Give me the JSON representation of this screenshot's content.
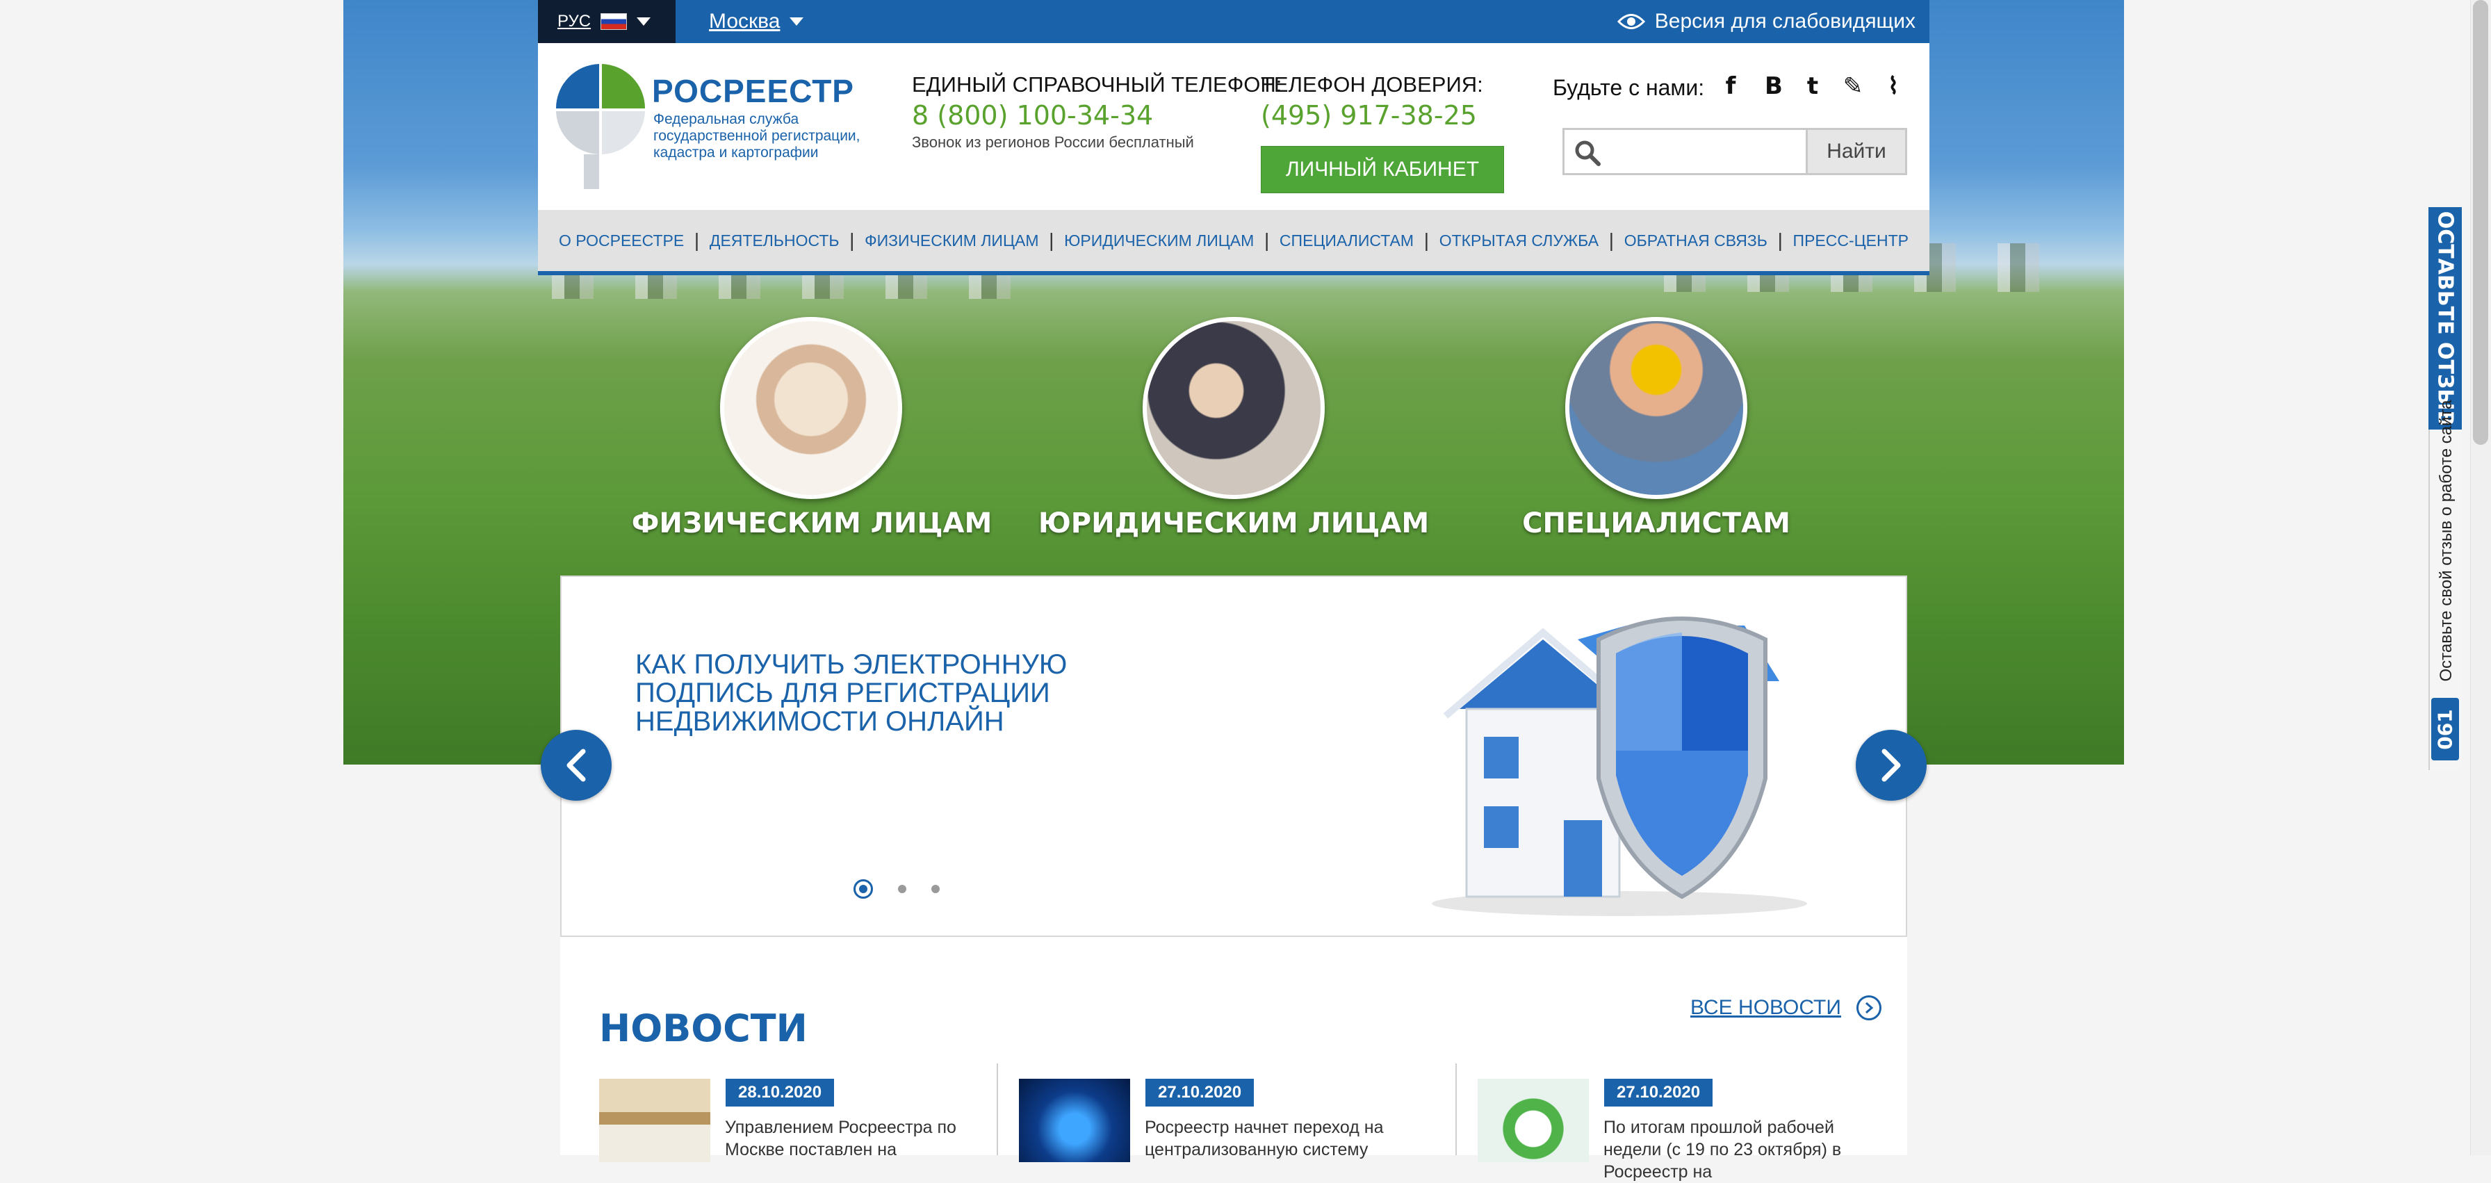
{
  "topbar": {
    "lang_code": "РУС",
    "city": "Москва",
    "accessibility_label": "Версия для слабовидящих"
  },
  "logo": {
    "title": "РОСРЕЕСТР",
    "subtitle": "Федеральная служба государственной регистрации, кадастра и картографии"
  },
  "contacts": {
    "hotline_label": "ЕДИНЫЙ СПРАВОЧНЫЙ ТЕЛЕФОН:",
    "hotline_number": "8 (800) 100-34-34",
    "hotline_note": "Звонок из регионов России бесплатный",
    "trust_label": "ТЕЛЕФОН ДОВЕРИЯ:",
    "trust_number": "(495) 917-38-25",
    "cabinet_button": "ЛИЧНЫЙ КАБИНЕТ"
  },
  "social": {
    "label": "Будьте с нами:",
    "icons": [
      "facebook-icon",
      "vkontakte-icon",
      "twitter-icon",
      "livejournal-icon",
      "rss-icon"
    ],
    "glyphs": [
      "f",
      "В",
      "t",
      "✎",
      "⌇"
    ]
  },
  "search": {
    "placeholder": "",
    "button": "Найти"
  },
  "nav": [
    "О РОСРЕЕСТРЕ",
    "ДЕЯТЕЛЬНОСТЬ",
    "ФИЗИЧЕСКИМ ЛИЦАМ",
    "ЮРИДИЧЕСКИМ ЛИЦАМ",
    "СПЕЦИАЛИСТАМ",
    "ОТКРЫТАЯ СЛУЖБА",
    "ОБРАТНАЯ СВЯЗЬ",
    "ПРЕСС-ЦЕНТР"
  ],
  "categories": [
    {
      "label": "ФИЗИЧЕСКИМ ЛИЦАМ"
    },
    {
      "label": "ЮРИДИЧЕСКИМ ЛИЦАМ"
    },
    {
      "label": "СПЕЦИАЛИСТАМ"
    }
  ],
  "slider": {
    "title": "КАК ПОЛУЧИТЬ ЭЛЕКТРОННУЮ ПОДПИСЬ ДЛЯ РЕГИСТРАЦИИ НЕДВИЖИМОСТИ ОНЛАЙН",
    "total_slides": 3,
    "active_slide": 1
  },
  "news": {
    "title": "НОВОСТИ",
    "all_link": "ВСЕ НОВОСТИ",
    "items": [
      {
        "date": "28.10.2020",
        "text": "Управлением Росреестра по Москве поставлен на"
      },
      {
        "date": "27.10.2020",
        "text": "Росреестр начнет переход на централизованную систему"
      },
      {
        "date": "27.10.2020",
        "text": "По итогам прошлой рабочей недели (с 19 по 23 октября) в Росреестр на"
      }
    ]
  },
  "feedback_tab": {
    "title": "ОСТАВЬТЕ ОТЗЫВ",
    "subtitle": "Оставьте свой отзыв о работе сайта",
    "counter": "061"
  },
  "colors": {
    "brand_blue": "#1a62a9",
    "green": "#5aa22e",
    "dark": "#0f1d33"
  }
}
